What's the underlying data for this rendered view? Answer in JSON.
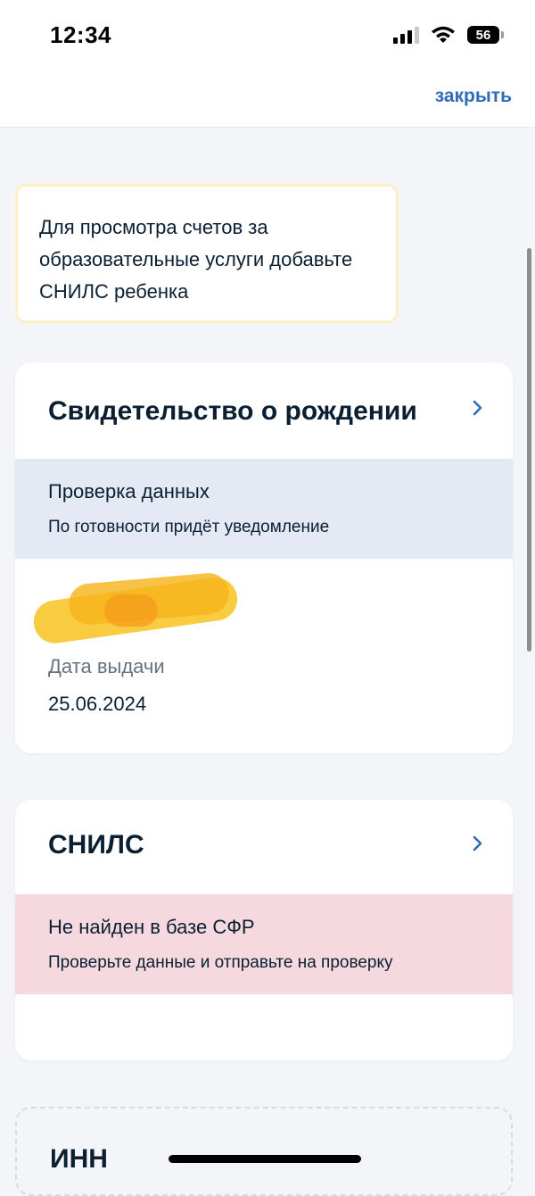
{
  "status_bar": {
    "time": "12:34",
    "battery_level": "56"
  },
  "nav": {
    "close_label": "закрыть"
  },
  "notice": {
    "text": "Для просмотра счетов за образовательные услуги добавьте СНИЛС ребенка"
  },
  "cards": [
    {
      "title": "Свидетельство о рождении",
      "status_title": "Проверка данных",
      "status_subtitle": "По готовности придёт уведомление",
      "field_label": "Дата выдачи",
      "field_value": "25.06.2024"
    },
    {
      "title": "СНИЛС",
      "status_title": "Не найден в базе СФР",
      "status_subtitle": "Проверьте данные и отправьте на проверку"
    },
    {
      "title": "ИНН"
    }
  ],
  "colors": {
    "link": "#2e6bb8",
    "info_status_bg": "#e4e9f3",
    "error_status_bg": "#f6d9de",
    "notice_border": "#fdf0c8"
  }
}
